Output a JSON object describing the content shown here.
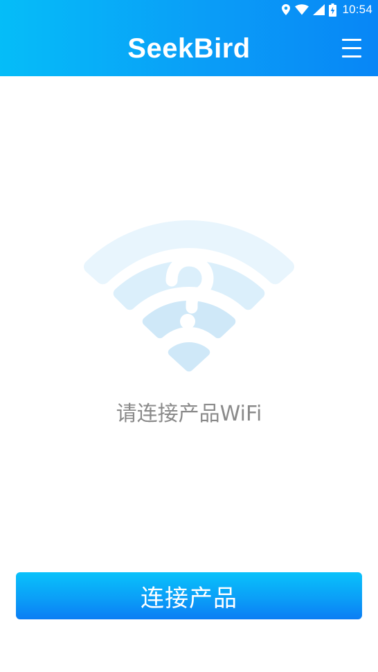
{
  "status_bar": {
    "time": "10:54",
    "icons": [
      "location-icon",
      "wifi-signal-icon",
      "cell-signal-icon",
      "battery-charging-icon"
    ]
  },
  "header": {
    "title": "SeekBird",
    "menu_icon": "hamburger-menu-icon"
  },
  "main": {
    "illustration_icon": "wifi-question-icon",
    "prompt": "请连接产品WiFi"
  },
  "footer": {
    "connect_button_label": "连接产品"
  },
  "colors": {
    "header_gradient_start": "#05bdf8",
    "header_gradient_end": "#0886f6",
    "button_gradient_top": "#09c2fb",
    "button_gradient_bottom": "#0b7df4",
    "wifi_outer_arc": "#e8f5fd",
    "wifi_mid_arc": "#dbeffb",
    "wifi_inner_arc": "#cfe8f8",
    "prompt_text": "#8a8a8a",
    "background": "#ffffff"
  }
}
